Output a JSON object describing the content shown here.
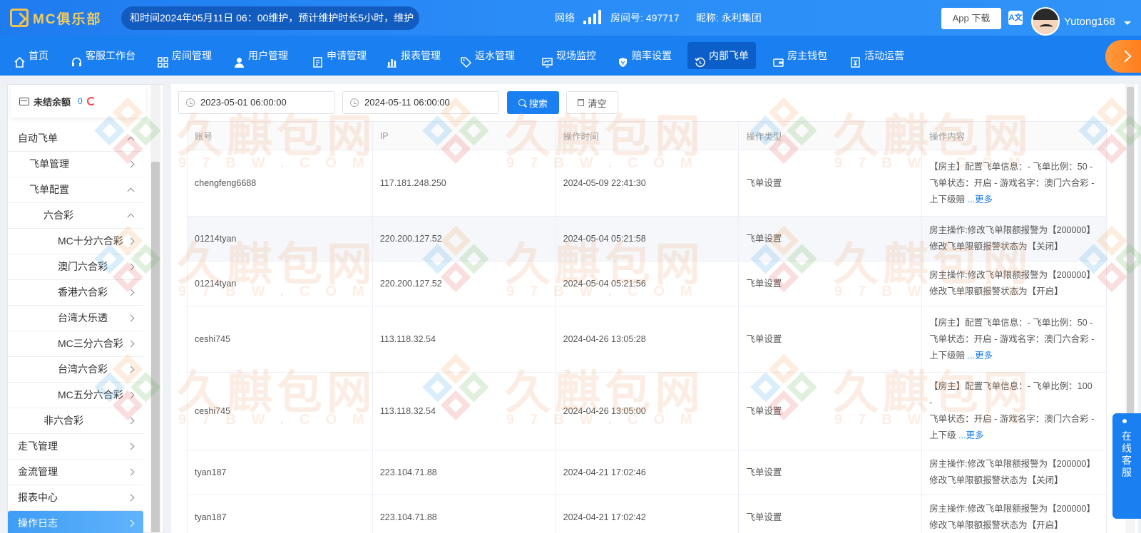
{
  "header": {
    "logo_text": "MC俱乐部",
    "marquee": "和时间2024年05月11日 06：00维护，预计维护时长5小时，维护",
    "network_label": "网络",
    "room_label": "房间号: 497717",
    "nickname_label": "昵称: 永利集团",
    "app_download": "App 下载",
    "translate_glyph": "A文",
    "username": "Yutong168"
  },
  "nav": {
    "items": [
      {
        "label": "首页"
      },
      {
        "label": "客服工作台"
      },
      {
        "label": "房间管理"
      },
      {
        "label": "用户管理"
      },
      {
        "label": "申请管理"
      },
      {
        "label": "报表管理"
      },
      {
        "label": "返水管理"
      },
      {
        "label": "现场监控"
      },
      {
        "label": "赔率设置"
      },
      {
        "label": "内部飞单"
      },
      {
        "label": "房主钱包"
      },
      {
        "label": "活动运营"
      }
    ],
    "active_index": 9
  },
  "sidebar": {
    "balance_label": "未结余额",
    "balance_value": "0",
    "menu": [
      {
        "label": "自动飞单",
        "level": 0,
        "expanded": true
      },
      {
        "label": "飞单管理",
        "level": 1,
        "expanded": false
      },
      {
        "label": "飞单配置",
        "level": 1,
        "expanded": true
      },
      {
        "label": "六合彩",
        "level": 2,
        "expanded": true
      },
      {
        "label": "MC十分六合彩",
        "level": 3,
        "expanded": false
      },
      {
        "label": "澳门六合彩",
        "level": 3,
        "expanded": false
      },
      {
        "label": "香港六合彩",
        "level": 3,
        "expanded": false
      },
      {
        "label": "台湾大乐透",
        "level": 3,
        "expanded": false
      },
      {
        "label": "MC三分六合彩",
        "level": 3,
        "expanded": false
      },
      {
        "label": "台湾六合彩",
        "level": 3,
        "expanded": false
      },
      {
        "label": "MC五分六合彩",
        "level": 3,
        "expanded": false
      },
      {
        "label": "非六合彩",
        "level": 2,
        "expanded": false
      },
      {
        "label": "走飞管理",
        "level": 0,
        "expanded": false
      },
      {
        "label": "金流管理",
        "level": 0,
        "expanded": false
      },
      {
        "label": "报表中心",
        "level": 0,
        "expanded": false
      },
      {
        "label": "操作日志",
        "level": 0,
        "expanded": false,
        "active": true
      }
    ]
  },
  "filters": {
    "start_date": "2023-05-01 06:00:00",
    "end_date": "2024-05-11 06:00:00",
    "search_label": "搜索",
    "clear_label": "清空"
  },
  "table": {
    "columns": [
      "账号",
      "IP",
      "操作时间",
      "操作类型",
      "操作内容"
    ],
    "rows": [
      {
        "account": "chengfeng6688",
        "ip": "117.181.248.250",
        "time": "2024-05-09 22:41:30",
        "type": "飞单设置",
        "lines": [
          "【房主】配置飞单信息：- 飞单比例：50 -",
          "飞单状态：开启 - 游戏名字：澳门六合彩 -",
          "上下级赔 "
        ],
        "more": "...更多"
      },
      {
        "account": "01214tyan",
        "ip": "220.200.127.52",
        "time": "2024-05-04 05:21:58",
        "type": "飞单设置",
        "lines": [
          "房主操作:修改飞单限额报警为【200000】",
          "修改飞单限额报警状态为【关闭】"
        ],
        "more": "",
        "highlight": true
      },
      {
        "account": "01214tyan",
        "ip": "220.200.127.52",
        "time": "2024-05-04 05:21:56",
        "type": "飞单设置",
        "lines": [
          "房主操作:修改飞单限额报警为【200000】",
          "修改飞单限额报警状态为【开启】"
        ],
        "more": ""
      },
      {
        "account": "ceshi745",
        "ip": "113.118.32.54",
        "time": "2024-04-26 13:05:28",
        "type": "飞单设置",
        "lines": [
          "【房主】配置飞单信息：- 飞单比例：50 -",
          "飞单状态：开启 - 游戏名字：澳门六合彩 -",
          "上下级赔 "
        ],
        "more": "...更多"
      },
      {
        "account": "ceshi745",
        "ip": "113.118.32.54",
        "time": "2024-04-26 13:05:00",
        "type": "飞单设置",
        "lines": [
          "【房主】配置飞单信息：- 飞单比例：100 -",
          "飞单状态：开启 - 游戏名字：澳门六合彩 -",
          "上下级 "
        ],
        "more": "...更多"
      },
      {
        "account": "tyan187",
        "ip": "223.104.71.88",
        "time": "2024-04-21 17:02:46",
        "type": "飞单设置",
        "lines": [
          "房主操作:修改飞单限额报警为【200000】",
          "修改飞单限额报警状态为【关闭】"
        ],
        "more": ""
      },
      {
        "account": "tyan187",
        "ip": "223.104.71.88",
        "time": "2024-04-21 17:02:42",
        "type": "飞单设置",
        "lines": [
          "房主操作:修改飞单限额报警为【200000】",
          "修改飞单限额报警状态为【开启】"
        ],
        "more": ""
      }
    ]
  },
  "chat_widget": {
    "label": "在线客服"
  },
  "watermark": {
    "text": "久麒包网",
    "sub": "97BW.COM"
  },
  "colors": {
    "primary": "#1a7ff0",
    "accent": "#ff8a2a",
    "logo": "#f6cb57"
  }
}
